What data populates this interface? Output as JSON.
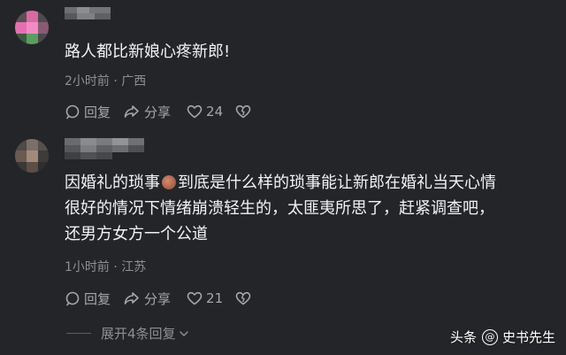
{
  "comments": [
    {
      "text_lines": [
        "路人都比新娘心疼新郎!"
      ],
      "meta": "2小时前 · 广西",
      "reply_label": "回复",
      "share_label": "分享",
      "like_count": "24"
    },
    {
      "text_lines": [
        "因婚礼的琐事",
        "到底是什么样的琐事能让新郎在婚礼当天心情",
        "很好的情况下情绪崩溃轻生的，太匪夷所思了，赶紧调查吧，",
        "还男方女方一个公道"
      ],
      "meta": "1小时前 · 江苏",
      "reply_label": "回复",
      "share_label": "分享",
      "like_count": "21"
    }
  ],
  "expand_label": "展开4条回复",
  "watermark": {
    "prefix": "头条",
    "author": "史书先生"
  },
  "colors": {
    "background": "#242528",
    "text": "#f2f2f4",
    "muted": "#8e8f94"
  },
  "icons": [
    "reply-icon",
    "share-icon",
    "heart-icon",
    "dislike-heart-icon",
    "chevron-down-icon",
    "at-icon"
  ]
}
